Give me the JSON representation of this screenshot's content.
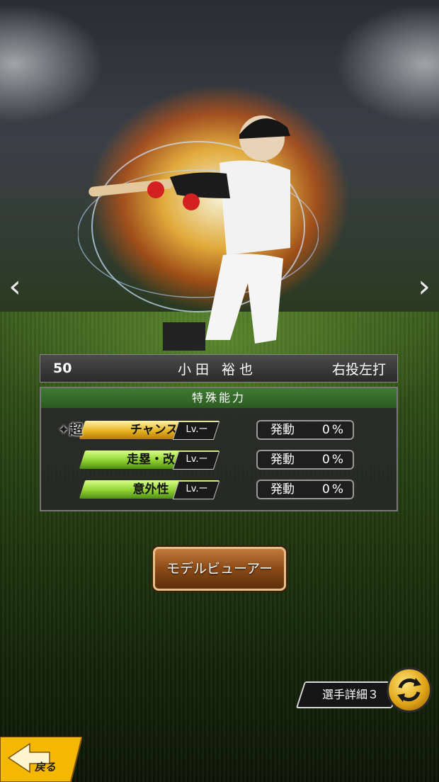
{
  "player": {
    "number": "50",
    "name": "小田 裕也",
    "handedness": "右投左打"
  },
  "abilities": {
    "header": "特殊能力",
    "items": [
      {
        "prefix": "超",
        "name": "チャンス◎",
        "level": "Lv.ー",
        "active_label": "発動",
        "rate": "0%",
        "style": "gold"
      },
      {
        "prefix": "",
        "name": "走塁・改",
        "level": "Lv.ー",
        "active_label": "発動",
        "rate": "0%",
        "style": "green"
      },
      {
        "prefix": "",
        "name": "意外性",
        "level": "Lv.ー",
        "active_label": "発動",
        "rate": "0%",
        "style": "green"
      }
    ]
  },
  "buttons": {
    "model_viewer": "モデルビューアー",
    "player_detail": "選手詳細３",
    "back": "戻る"
  },
  "nav": {
    "prev_icon": "chevron-left-icon",
    "next_icon": "chevron-right-icon"
  },
  "colors": {
    "gold_tag": "#e5b422",
    "green_tag": "#8fd132",
    "panel_header": "#3f7a32",
    "back_button": "#f5b800"
  }
}
